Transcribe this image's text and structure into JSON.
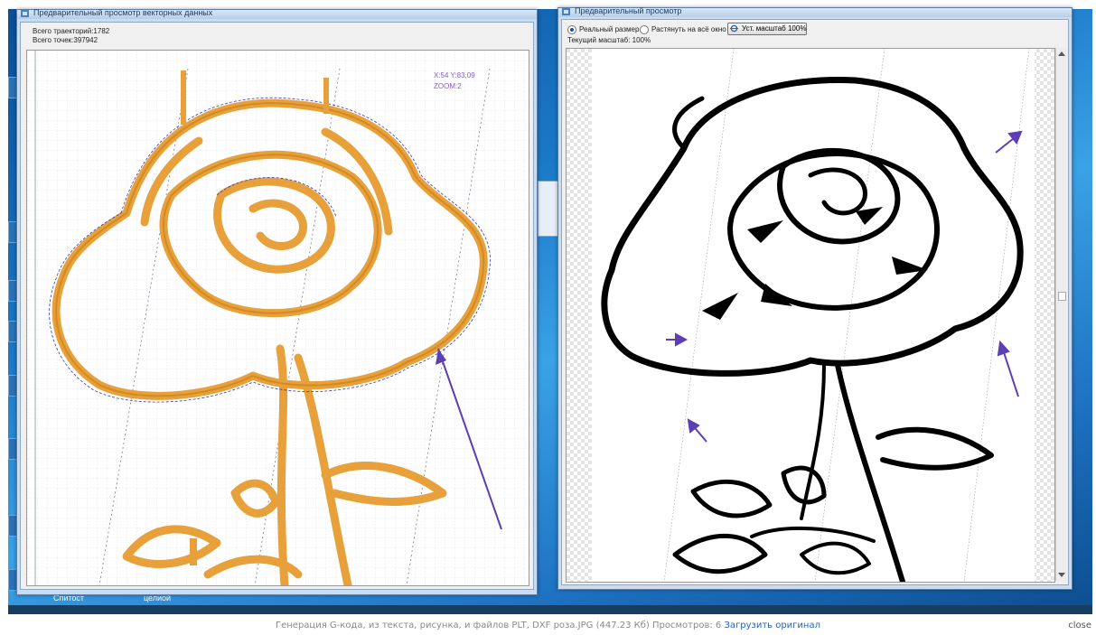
{
  "colors": {
    "accent_orange": "#e8a03a",
    "arrow_purple": "#5b3fb3",
    "title_text": "#1e395b",
    "link": "#2a62b5"
  },
  "desktop": {
    "taskbar_items": [
      "Спитост",
      "целиой"
    ]
  },
  "left_window": {
    "title": "Предварительный просмотр векторных данных",
    "stats": {
      "trajectories": "Всего траекторий:1782",
      "points": "Всего точек:397942"
    },
    "cursor": {
      "coords": "X:54 Y:83,09",
      "zoom": "ZOOM:2"
    }
  },
  "right_window": {
    "title": "Предварительный просмотр",
    "options": [
      {
        "label": "Реальный размер",
        "selected": true
      },
      {
        "label": "Растянуть на всё окно",
        "selected": false
      }
    ],
    "zoom_button": "Уст. масштаб 100%",
    "current_scale": "Текущий масштаб: 100%"
  },
  "caption": {
    "text": "Генерация G-кода, из текста, рисунка, и файлов PLT, DXF роза.JPG (447.23 Кб) Просмотров: 6",
    "download_link": "Загрузить оригинал",
    "close": "close"
  },
  "icons": [
    "app-icon",
    "arrow-icon",
    "zoom-icon",
    "scroll-up-icon",
    "scroll-down-icon"
  ]
}
